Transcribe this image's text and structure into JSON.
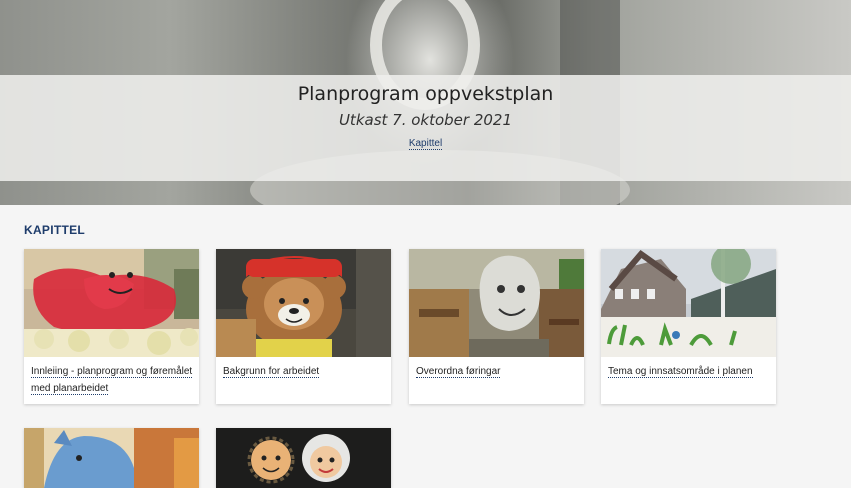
{
  "hero": {
    "title": "Planprogram oppvekstplan",
    "subtitle": "Utkast 7. oktober 2021",
    "link": "Kapittel"
  },
  "section": {
    "title": "KAPITTEL"
  },
  "cards": [
    {
      "label": "Innleiing - planprogram og føremålet med planarbeidet"
    },
    {
      "label": "Bakgrunn for arbeidet"
    },
    {
      "label": "Overordna føringar"
    },
    {
      "label": "Tema og innsatsområde i planen"
    }
  ]
}
